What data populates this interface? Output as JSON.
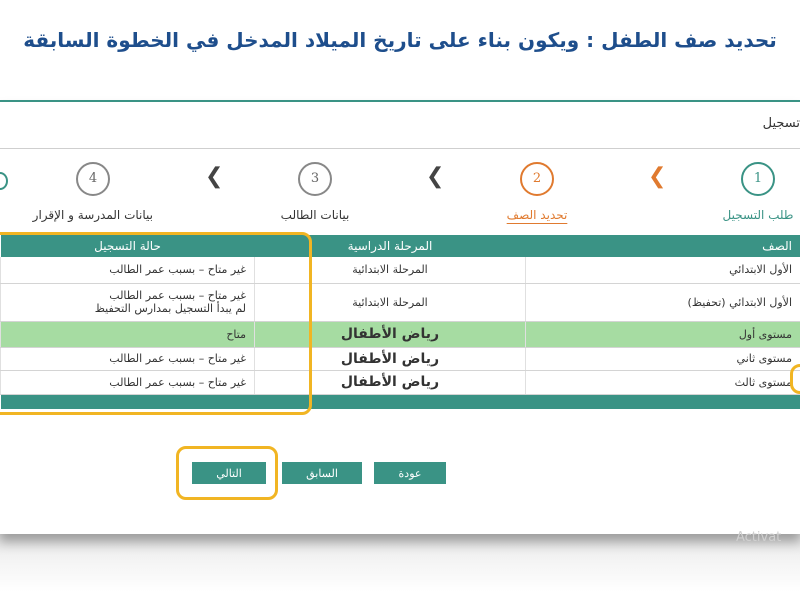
{
  "heading": "تحديد صف الطفل : ويكون بناء على تاريخ الميلاد المدخل في الخطوة السابقة",
  "panel": {
    "title": "تسجيل"
  },
  "steps": [
    {
      "number": "1",
      "label": "طلب التسجيل"
    },
    {
      "number": "2",
      "label": "تحديد الصف"
    },
    {
      "number": "3",
      "label": "بيانات الطالب"
    },
    {
      "number": "4",
      "label": "بيانات المدرسة و الإقرار"
    }
  ],
  "table": {
    "headers": {
      "class": "الصف",
      "stage": "المرحلة الدراسية",
      "status": "حالة التسجيل"
    },
    "rows": [
      {
        "class": "الأول الابتدائي",
        "stage": "المرحلة الابتدائية",
        "status": "غير متاح – بسبب عمر الطالب",
        "status2": ""
      },
      {
        "class": "الأول الابتدائي (تحفيظ)",
        "stage": "المرحلة الابتدائية",
        "status": "غير متاح – بسبب عمر الطالب",
        "status2": "لم يبدأ التسجيل بمدارس التحفيظ"
      },
      {
        "class": "مستوى أول",
        "stage": "رياض الأطفال",
        "status": "متاح",
        "status2": ""
      },
      {
        "class": "مستوى ثاني",
        "stage": "رياض الأطفال",
        "status": "غير متاح – بسبب عمر الطالب",
        "status2": ""
      },
      {
        "class": "مستوى ثالث",
        "stage": "رياض الأطفال",
        "status": "غير متاح – بسبب عمر الطالب",
        "status2": ""
      }
    ]
  },
  "buttons": {
    "next": "التالي",
    "prev": "السابق",
    "back": "عودة"
  },
  "watermark": "Activat",
  "colors": {
    "primary": "#3a9385",
    "active_step": "#e07a2f",
    "highlight_row": "#a6dca2",
    "annotation": "#f1b523",
    "heading": "#1e4e8c"
  }
}
